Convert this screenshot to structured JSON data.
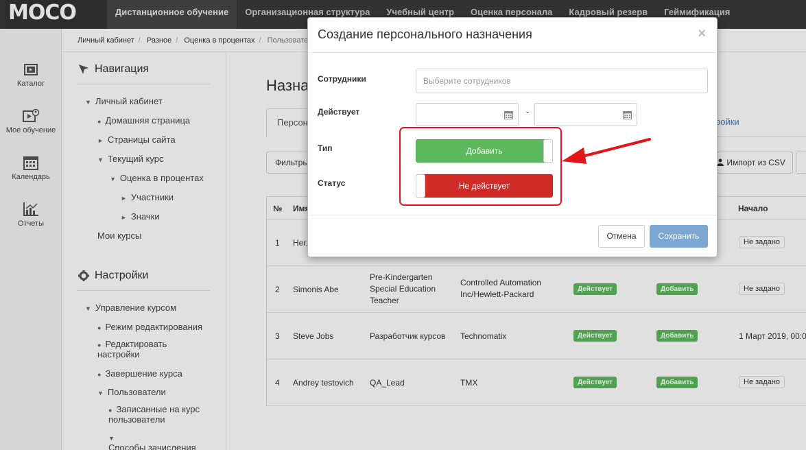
{
  "brand": {
    "logo": "MOCO"
  },
  "topnav": [
    "Дистанционное обучение",
    "Организационная структура",
    "Учебный центр",
    "Оценка персонала",
    "Кадровый резерв",
    "Геймификация"
  ],
  "rail": {
    "catalog": "Каталог",
    "my_learning": "Мое обучение",
    "calendar": "Календарь",
    "reports": "Отчеты"
  },
  "breadcrumb": [
    "Личный кабинет",
    "Разное",
    "Оценка в процентах",
    "Пользовател"
  ],
  "sidebar": {
    "nav_title": "Навигация",
    "nav_items": [
      "Личный кабинет",
      "Домашняя страница",
      "Страницы сайта",
      "Текущий курс",
      "Оценка в процентах",
      "Участники",
      "Значки",
      "Мои курсы"
    ],
    "settings_title": "Настройки",
    "settings_items": [
      "Управление курсом",
      "Режим редактирования",
      "Редактировать",
      "настройки",
      "Завершение курса",
      "Пользователи",
      "Записанные на курс",
      "пользователи",
      "Способы зачисления"
    ]
  },
  "page": {
    "title": "Назна",
    "tab_active": "Персона",
    "tab_right": "ройки",
    "filter_button": "Фильтры",
    "import_button": "Импорт из CSV"
  },
  "table": {
    "headers": [
      "№",
      "Имя",
      "Начало"
    ],
    "rows": [
      {
        "num": "1",
        "name": "Негл",
        "position": "",
        "company": "",
        "status": "",
        "type": "",
        "start": "Не задано"
      },
      {
        "num": "2",
        "name": "Simonis Abe",
        "position": "Pre-Kindergarten Special Education Teacher",
        "company": "Controlled Automation Inc/Hewlett-Packard",
        "status": "Действует",
        "type": "Добавить",
        "start": "Не задано"
      },
      {
        "num": "3",
        "name": "Steve Jobs",
        "position": "Разработчик курсов",
        "company": "Technomatix",
        "status": "Действует",
        "type": "Добавить",
        "start": "1 Март 2019, 00:0"
      },
      {
        "num": "4",
        "name": "Andrey testovich",
        "position": "QA_Lead",
        "company": "TMX",
        "status": "Действует",
        "type": "Добавить",
        "start": "Не задано"
      }
    ]
  },
  "modal": {
    "title": "Создание персонального назначения",
    "close": "×",
    "employees_label": "Сотрудники",
    "employees_placeholder": "Выберите сотрудников",
    "active_label": "Действует",
    "date_separator": "-",
    "type_label": "Тип",
    "type_value": "Добавить",
    "status_label": "Статус",
    "status_value": "Не действует",
    "cancel": "Отмена",
    "save": "Сохранить"
  },
  "colors": {
    "accent_green": "#5cb85c",
    "accent_red": "#d12b27",
    "save_blue": "#7ba7d2",
    "highlight": "#e2161a"
  }
}
